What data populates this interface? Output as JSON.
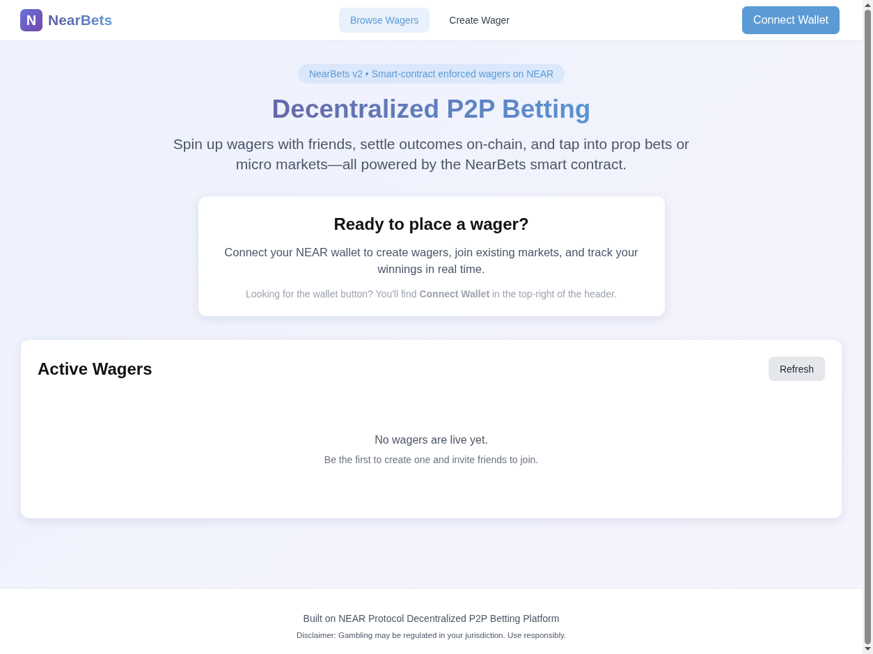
{
  "header": {
    "logo": {
      "mark": "N",
      "name": "NearBets"
    },
    "nav": [
      {
        "label": "Browse Wagers",
        "selected": true
      },
      {
        "label": "Create Wager",
        "selected": false
      }
    ],
    "connect_button": "Connect Wallet"
  },
  "hero": {
    "badge": "NearBets v2 • Smart-contract enforced wagers on NEAR",
    "title": "Decentralized P2P Betting",
    "subtitle": "Spin up wagers with friends, settle outcomes on-chain, and tap into prop bets or micro markets—all powered by the NearBets smart contract."
  },
  "wallet_prompt": {
    "title": "Ready to place a wager?",
    "description": "Connect your NEAR wallet to create wagers, join existing markets, and track your winnings in real time.",
    "hint": "Looking for the wallet button? You'll find **Connect Wallet** in the top-right of the header."
  },
  "active_wagers": {
    "title": "Active Wagers",
    "refresh_button": "Refresh",
    "empty_title": "No wagers are live yet.",
    "empty_hint": "Be the first to create one and invite friends to join."
  },
  "footer": {
    "line": "Built on NEAR Protocol Decentralized P2P Betting Platform",
    "disclaimer": "Disclaimer: Gambling may be regulated in your jurisdiction. Use responsibly."
  }
}
